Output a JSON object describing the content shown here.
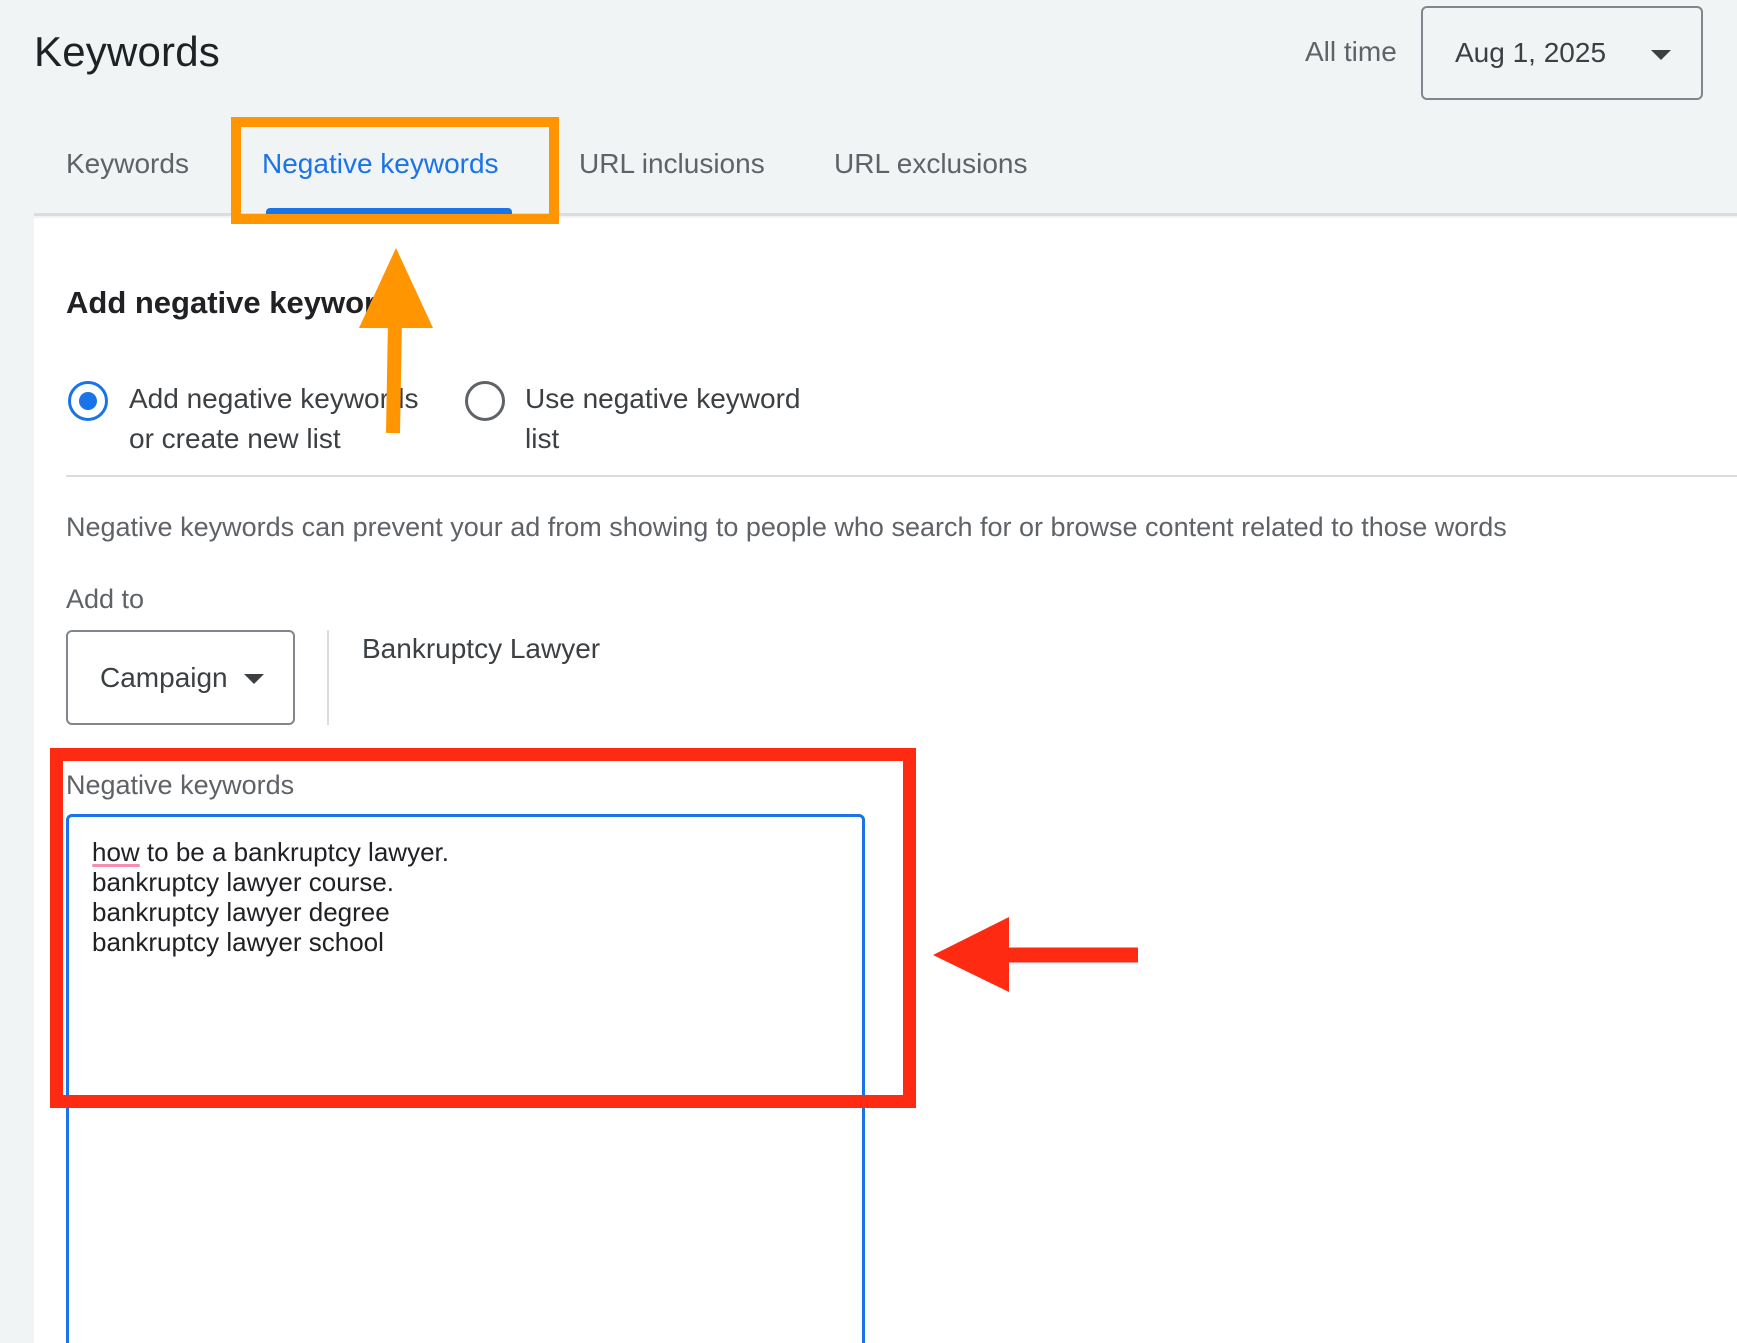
{
  "header": {
    "title": "Keywords",
    "date_range_label": "All time",
    "date_value": "Aug 1, 2025"
  },
  "tabs": [
    {
      "label": "Keywords",
      "active": false
    },
    {
      "label": "Negative keywords",
      "active": true
    },
    {
      "label": "URL inclusions",
      "active": false
    },
    {
      "label": "URL exclusions",
      "active": false
    }
  ],
  "form": {
    "section_title": "Add negative keywords",
    "radio_options": [
      {
        "label": "Add negative keywords or create new list",
        "checked": true
      },
      {
        "label": "Use negative keyword list",
        "checked": false
      }
    ],
    "description": "Negative keywords can prevent your ad from showing to people who search for or browse content related to those words",
    "add_to_label": "Add to",
    "level_value": "Campaign",
    "campaign_name": "Bankruptcy Lawyer",
    "negative_keywords_label": "Negative keywords",
    "negative_keywords_value": "how to be a bankruptcy lawyer.\nbankruptcy lawyer course.\nbankruptcy lawyer degree\nbankruptcy lawyer school"
  },
  "colors": {
    "accent": "#1a73e8",
    "annotation_orange": "#ff9500",
    "annotation_red": "#ff2a12"
  },
  "icons": {
    "date_dropdown": "chevron-down-icon",
    "level_dropdown": "chevron-down-icon",
    "annotation_up": "arrow-up-icon",
    "annotation_left": "arrow-left-icon"
  }
}
